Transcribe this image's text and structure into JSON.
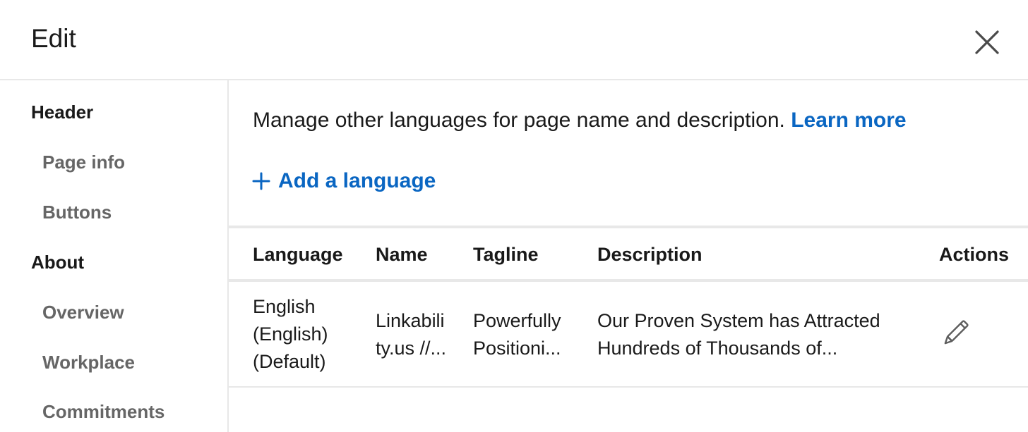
{
  "dialog": {
    "title": "Edit"
  },
  "sidebar": {
    "sections": [
      {
        "label": "Header",
        "items": [
          {
            "label": "Page info"
          },
          {
            "label": "Buttons"
          }
        ]
      },
      {
        "label": "About",
        "items": [
          {
            "label": "Overview"
          },
          {
            "label": "Workplace"
          },
          {
            "label": "Commitments"
          }
        ]
      }
    ]
  },
  "main": {
    "intro_text": "Manage other languages for page name and description.",
    "learn_more": "Learn more",
    "add_language": "Add a language",
    "table": {
      "columns": [
        "Language",
        "Name",
        "Tagline",
        "Description",
        "Actions"
      ],
      "rows": [
        {
          "language": [
            "English",
            "(English)",
            "(Default)"
          ],
          "name": [
            "Linkabili",
            "ty.us //..."
          ],
          "tagline": [
            "Powerfully",
            "Positioni..."
          ],
          "description": [
            "Our Proven System has Attracted",
            "Hundreds of Thousands of..."
          ]
        }
      ]
    }
  },
  "icons": {
    "close": "close-icon",
    "add": "plus-icon",
    "edit": "pencil-icon"
  },
  "colors": {
    "link": "#0a66c2",
    "muted": "#666666",
    "divider": "#e8e8e8"
  }
}
